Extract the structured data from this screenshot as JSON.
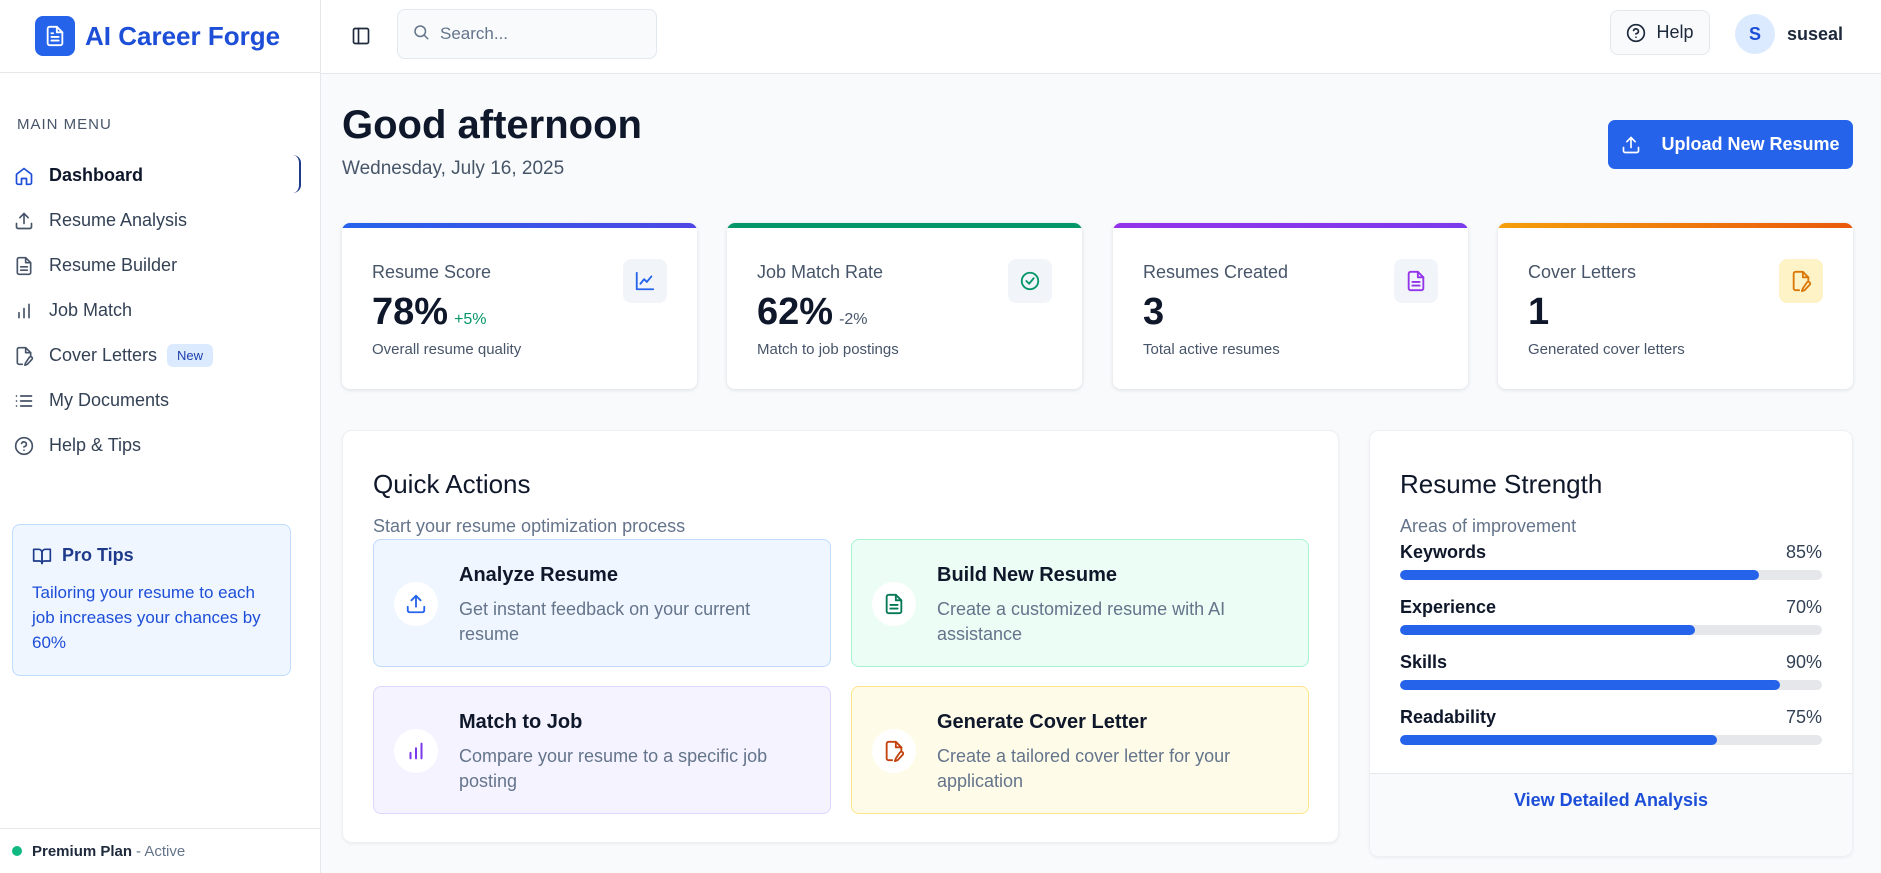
{
  "app": {
    "name": "AI Career Forge"
  },
  "sidebar": {
    "menu_title": "MAIN MENU",
    "items": [
      {
        "label": "Dashboard",
        "icon": "home-icon"
      },
      {
        "label": "Resume Analysis",
        "icon": "upload-icon"
      },
      {
        "label": "Resume Builder",
        "icon": "document-icon"
      },
      {
        "label": "Job Match",
        "icon": "bar-chart-icon"
      },
      {
        "label": "Cover Letters",
        "icon": "file-signature-icon",
        "badge": "New"
      },
      {
        "label": "My Documents",
        "icon": "list-icon"
      },
      {
        "label": "Help & Tips",
        "icon": "help-circle-icon"
      }
    ],
    "tips": {
      "title": "Pro Tips",
      "body": "Tailoring your resume to each job increases your chances by 60%"
    },
    "plan": {
      "name": "Premium Plan",
      "status": "- Active"
    }
  },
  "topbar": {
    "search_placeholder": "Search...",
    "help_label": "Help",
    "user": {
      "initial": "S",
      "name": "suseal"
    }
  },
  "header": {
    "greeting": "Good afternoon",
    "date": "Wednesday, July 16, 2025",
    "upload_label": "Upload New Resume"
  },
  "stats": [
    {
      "label": "Resume Score",
      "value": "78%",
      "delta": "+5%",
      "sub": "Overall resume quality",
      "color": "#2563eb",
      "icon": "line-chart-icon"
    },
    {
      "label": "Job Match Rate",
      "value": "62%",
      "delta": "-2%",
      "sub": "Match to job postings",
      "color": "#059669",
      "icon": "check-circle-icon"
    },
    {
      "label": "Resumes Created",
      "value": "3",
      "sub": "Total active resumes",
      "color": "#9333ea",
      "icon": "document-icon"
    },
    {
      "label": "Cover Letters",
      "value": "1",
      "sub": "Generated cover letters",
      "color": "#ea580c",
      "icon": "file-signature-icon"
    }
  ],
  "quick_actions": {
    "title": "Quick Actions",
    "subtitle": "Start your resume optimization process",
    "items": [
      {
        "title": "Analyze Resume",
        "desc": "Get instant feedback on your current resume",
        "icon": "upload-icon"
      },
      {
        "title": "Build New Resume",
        "desc": "Create a customized resume with AI assistance",
        "icon": "document-icon"
      },
      {
        "title": "Match to Job",
        "desc": "Compare your resume to a specific job posting",
        "icon": "bar-chart-icon"
      },
      {
        "title": "Generate Cover Letter",
        "desc": "Create a tailored cover letter for your application",
        "icon": "file-signature-icon"
      }
    ]
  },
  "strength": {
    "title": "Resume Strength",
    "subtitle": "Areas of improvement",
    "skills": [
      {
        "name": "Keywords",
        "pct": "85%",
        "value": 85
      },
      {
        "name": "Experience",
        "pct": "70%",
        "value": 70
      },
      {
        "name": "Skills",
        "pct": "90%",
        "value": 90
      },
      {
        "name": "Readability",
        "pct": "75%",
        "value": 75
      }
    ],
    "link": "View Detailed Analysis"
  }
}
